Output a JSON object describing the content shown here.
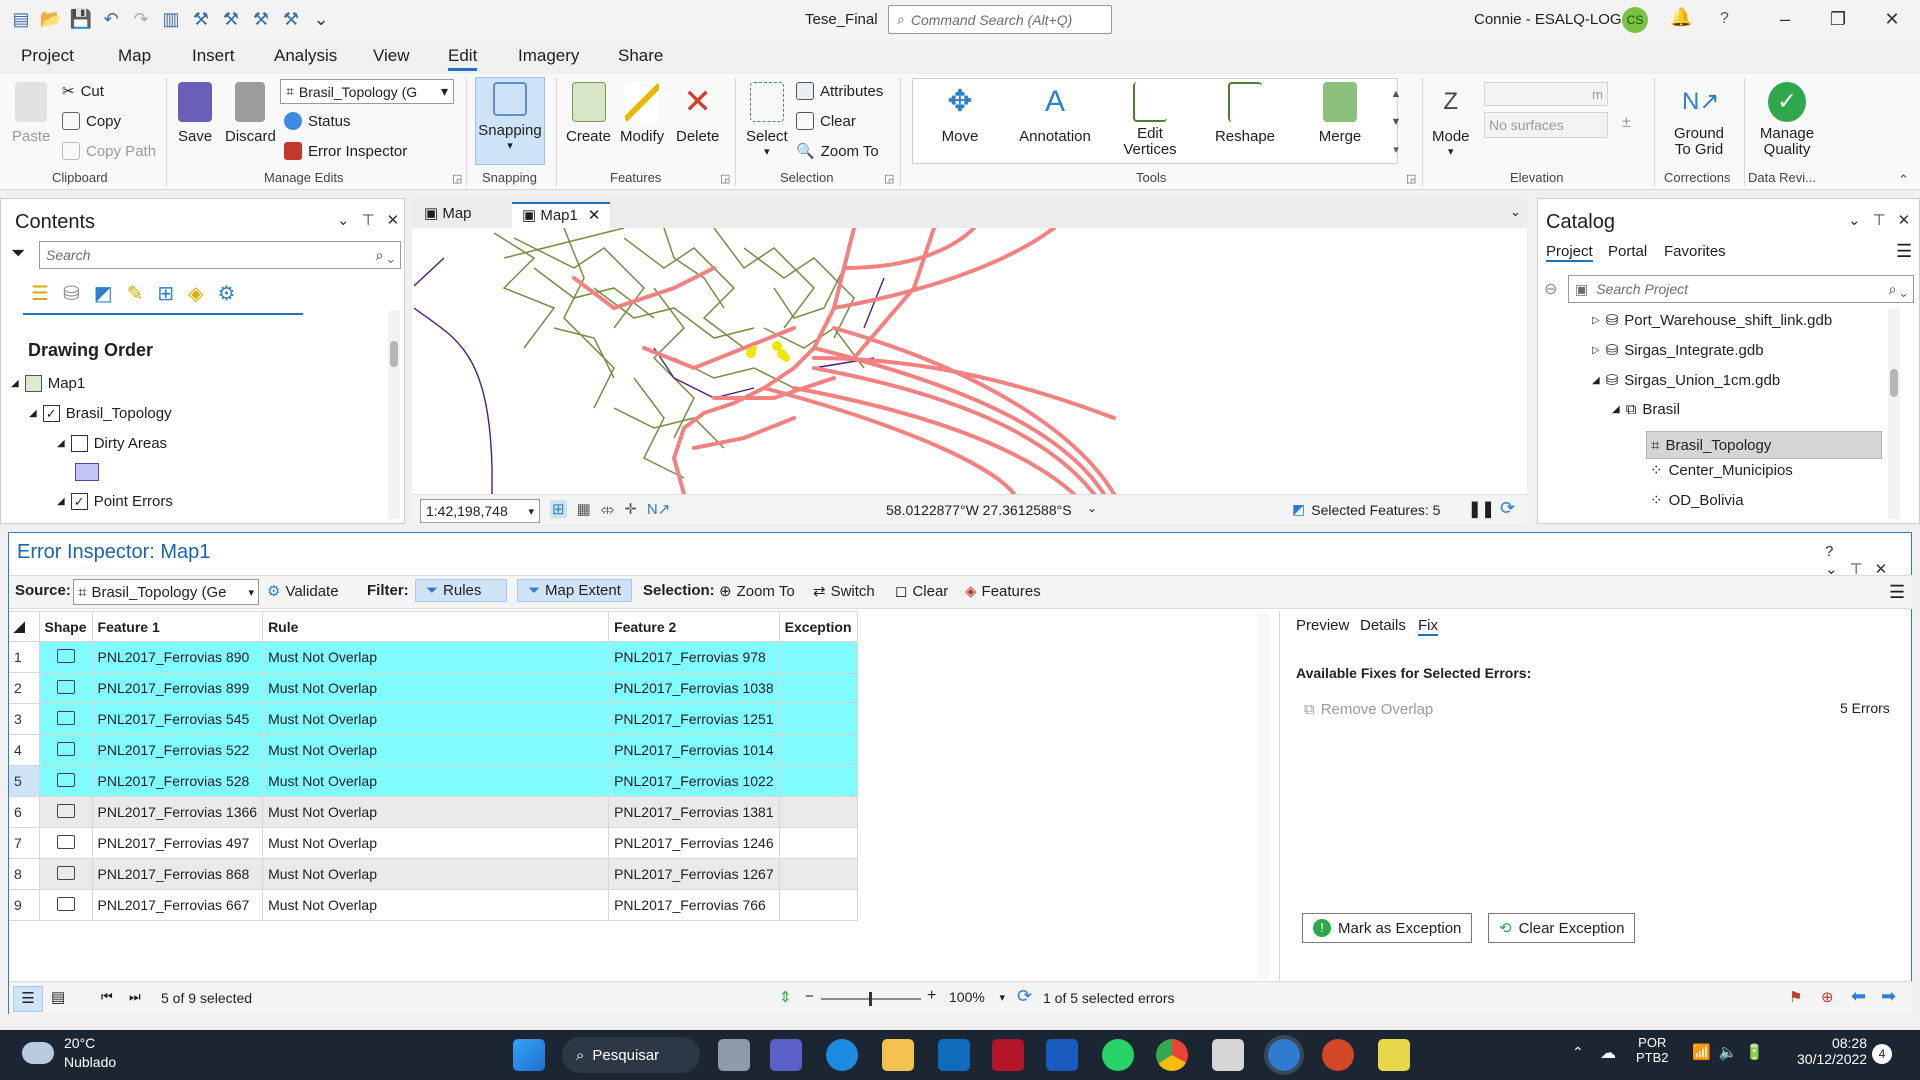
{
  "titlebar": {
    "doc_title": "Tese_Final",
    "command_search_placeholder": "Command Search (Alt+Q)",
    "user_name": "Connie - ESALQ-LOG",
    "user_initials": "CS",
    "help": "?"
  },
  "ribbon_tabs": [
    "Project",
    "Map",
    "Insert",
    "Analysis",
    "View",
    "Edit",
    "Imagery",
    "Share"
  ],
  "active_tab": "Edit",
  "clipboard": {
    "paste": "Paste",
    "cut": "Cut",
    "copy": "Copy",
    "copy_path": "Copy Path",
    "label": "Clipboard"
  },
  "manage_edits": {
    "save": "Save",
    "discard": "Discard",
    "topology_select": "Brasil_Topology (G",
    "status": "Status",
    "error_inspector": "Error Inspector",
    "label": "Manage Edits"
  },
  "snapping": {
    "button": "Snapping",
    "label": "Snapping"
  },
  "features": {
    "create": "Create",
    "modify": "Modify",
    "delete": "Delete",
    "label": "Features"
  },
  "selection": {
    "select": "Select",
    "attributes": "Attributes",
    "clear": "Clear",
    "zoom_to": "Zoom To",
    "label": "Selection"
  },
  "tools": {
    "move": "Move",
    "annotation": "Annotation",
    "edit_vertices": "Edit Vertices",
    "reshape": "Reshape",
    "merge": "Merge",
    "label": "Tools"
  },
  "elevation": {
    "mode": "Mode",
    "unit": "m",
    "no_surfaces": "No surfaces",
    "label": "Elevation"
  },
  "corrections": {
    "ground_to_grid": "Ground To Grid",
    "label": "Corrections"
  },
  "data_review": {
    "manage_quality": "Manage Quality",
    "label": "Data Revi..."
  },
  "contents": {
    "title": "Contents",
    "search_placeholder": "Search",
    "drawing_order": "Drawing Order",
    "items": [
      "Map1",
      "Brasil_Topology",
      "Dirty Areas",
      "Point Errors"
    ]
  },
  "map": {
    "tabs": [
      "Map",
      "Map1"
    ],
    "active_tab": "Map1",
    "scale": "1:42,198,748",
    "coordinates": "58.0122877°W 27.3612588°S",
    "selected_features": "Selected Features: 5"
  },
  "catalog": {
    "title": "Catalog",
    "tabs": [
      "Project",
      "Portal",
      "Favorites"
    ],
    "search_placeholder": "Search Project",
    "items": [
      "Port_Warehouse_shift_link.gdb",
      "Sirgas_Integrate.gdb",
      "Sirgas_Union_1cm.gdb",
      "Brasil",
      "Brasil_Topology",
      "Center_Municipios",
      "OD_Bolivia"
    ],
    "selected_item": "Brasil_Topology"
  },
  "inspector": {
    "title": "Error Inspector: Map1",
    "source_label": "Source:",
    "source_value": "Brasil_Topology (Ge",
    "validate": "Validate",
    "filter_label": "Filter:",
    "rules": "Rules",
    "map_extent": "Map Extent",
    "selection_label": "Selection:",
    "zoom_to": "Zoom To",
    "switch": "Switch",
    "clear": "Clear",
    "features": "Features",
    "columns": [
      "Shape",
      "Feature 1",
      "Rule",
      "Feature 2",
      "Exception"
    ],
    "rows": [
      {
        "n": "1",
        "f1": "PNL2017_Ferrovias 890",
        "rule": "Must Not Overlap",
        "f2": "PNL2017_Ferrovias 978",
        "sel": true
      },
      {
        "n": "2",
        "f1": "PNL2017_Ferrovias 899",
        "rule": "Must Not Overlap",
        "f2": "PNL2017_Ferrovias 1038",
        "sel": true
      },
      {
        "n": "3",
        "f1": "PNL2017_Ferrovias 545",
        "rule": "Must Not Overlap",
        "f2": "PNL2017_Ferrovias 1251",
        "sel": true
      },
      {
        "n": "4",
        "f1": "PNL2017_Ferrovias 522",
        "rule": "Must Not Overlap",
        "f2": "PNL2017_Ferrovias 1014",
        "sel": true
      },
      {
        "n": "5",
        "f1": "PNL2017_Ferrovias 528",
        "rule": "Must Not Overlap",
        "f2": "PNL2017_Ferrovias 1022",
        "sel": true
      },
      {
        "n": "6",
        "f1": "PNL2017_Ferrovias 1366",
        "rule": "Must Not Overlap",
        "f2": "PNL2017_Ferrovias 1381",
        "sel": false
      },
      {
        "n": "7",
        "f1": "PNL2017_Ferrovias 497",
        "rule": "Must Not Overlap",
        "f2": "PNL2017_Ferrovias 1246",
        "sel": false
      },
      {
        "n": "8",
        "f1": "PNL2017_Ferrovias 868",
        "rule": "Must Not Overlap",
        "f2": "PNL2017_Ferrovias 1267",
        "sel": false
      },
      {
        "n": "9",
        "f1": "PNL2017_Ferrovias 667",
        "rule": "Must Not Overlap",
        "f2": "PNL2017_Ferrovias 766",
        "sel": false
      }
    ],
    "fix_tabs": [
      "Preview",
      "Details",
      "Fix"
    ],
    "active_fix_tab": "Fix",
    "available_fixes": "Available Fixes for Selected Errors:",
    "remove_overlap": "Remove Overlap",
    "error_count": "5  Errors",
    "mark_exception": "Mark as Exception",
    "clear_exception": "Clear Exception",
    "selected_count": "5 of 9 selected",
    "zoom_pct": "100%",
    "selected_errors": "1 of 5 selected errors"
  },
  "taskbar": {
    "temperature": "20°C",
    "weather": "Nublado",
    "search": "Pesquisar",
    "lang1": "POR",
    "lang2": "PTB2",
    "time": "08:28",
    "date": "30/12/2022",
    "notif_count": "4"
  }
}
